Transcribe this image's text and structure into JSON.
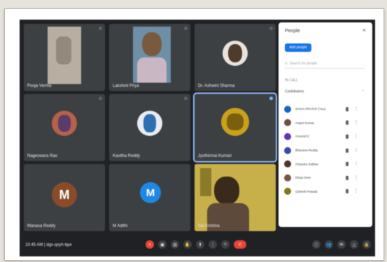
{
  "meeting": {
    "time_and_code": "10:45 AM  |  dgx-qxyh-bpe",
    "code_label": "dgx-qxyh-bpe"
  },
  "tiles": [
    {
      "name": "Pooja Verma"
    },
    {
      "name": "Lakshmi Priya"
    },
    {
      "name": "Dr. Ashwini Sharma"
    },
    {
      "name": "Nageswara Rao"
    },
    {
      "name": "Kavitha Reddy"
    },
    {
      "name": "Jyothirmai Kumari"
    },
    {
      "name": "Manasa Reddy",
      "initial": "M"
    },
    {
      "name": "M Adithi",
      "initial": "M"
    },
    {
      "name": "Sai Krishna"
    }
  ],
  "panel": {
    "title": "People",
    "add_label": "Add people",
    "search_placeholder": "Search for people",
    "section_label": "IN CALL",
    "group_label": "Contributors",
    "participants": [
      {
        "name": "SHIVA PRATAP (You)",
        "color": "#1565c0"
      },
      {
        "name": "Anjani Kumar",
        "color": "#6d4c41"
      },
      {
        "name": "Aravind S",
        "color": "#5e35b1"
      },
      {
        "name": "Bhavana Reddy",
        "color": "#3949ab"
      },
      {
        "name": "Chandra Sekhar",
        "color": "#4e342e"
      },
      {
        "name": "Divya Sree",
        "color": "#795548"
      },
      {
        "name": "Ganesh Prasad",
        "color": "#827717"
      }
    ]
  },
  "colors": {
    "background": "#202124",
    "tile": "#3c4043",
    "accent": "#1a73e8",
    "end_call": "#ea4335",
    "speaking_outline": "#8ab4f8"
  }
}
